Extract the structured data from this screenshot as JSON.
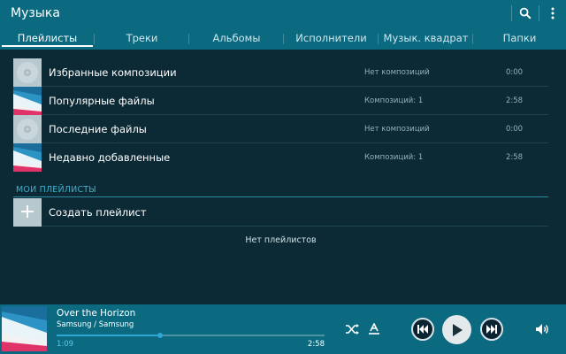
{
  "app": {
    "title": "Музыка"
  },
  "action_bar": {
    "search_icon": "search-icon",
    "menu_icon": "more-vertical-icon"
  },
  "tabs": [
    {
      "label": "Плейлисты",
      "active": true
    },
    {
      "label": "Треки",
      "active": false
    },
    {
      "label": "Альбомы",
      "active": false
    },
    {
      "label": "Исполнители",
      "active": false
    },
    {
      "label": "Музык. квадрат",
      "active": false
    },
    {
      "label": "Папки",
      "active": false
    }
  ],
  "playlists": [
    {
      "title": "Избранные композиции",
      "count": "Нет композиций",
      "duration": "0:00",
      "art": "disc"
    },
    {
      "title": "Популярные файлы",
      "count": "Композиций: 1",
      "duration": "2:58",
      "art": "cover"
    },
    {
      "title": "Последние файлы",
      "count": "Нет композиций",
      "duration": "0:00",
      "art": "disc"
    },
    {
      "title": "Недавно добавленные",
      "count": "Композиций: 1",
      "duration": "2:58",
      "art": "cover"
    }
  ],
  "my_playlists": {
    "section_title": "МОИ ПЛЕЙЛИСТЫ",
    "create_label": "Создать плейлист",
    "empty_text": "Нет плейлистов"
  },
  "player": {
    "song_title": "Over the Horizon",
    "artist_album": "Samsung / Samsung",
    "time_elapsed": "1:09",
    "time_total": "2:58",
    "progress_fraction": 0.387
  },
  "colors": {
    "accent": "#0b6a80",
    "background": "#0c2a35",
    "section": "#3fb0cc",
    "progress": "#2ea7d8"
  }
}
